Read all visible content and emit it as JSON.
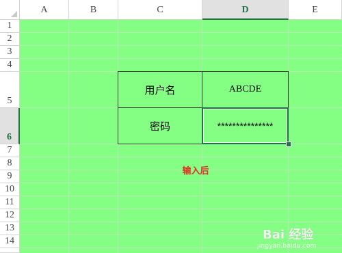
{
  "columns": [
    "A",
    "B",
    "C",
    "D",
    "E"
  ],
  "rows": [
    "1",
    "2",
    "3",
    "4",
    "5",
    "6",
    "7",
    "8",
    "9",
    "10",
    "11",
    "12",
    "13",
    "14"
  ],
  "selection": {
    "column": "D",
    "row": "6"
  },
  "table": {
    "username_label": "用户名",
    "username_value": "ABCDE",
    "password_label": "密码",
    "password_value": "***************"
  },
  "note": "输入后",
  "watermark": {
    "logo": "Bai 经验",
    "url": "jingyan.baidu.com"
  },
  "colors": {
    "sheet_fill": "#84ff84",
    "note": "#e03020",
    "accent": "#217346"
  }
}
